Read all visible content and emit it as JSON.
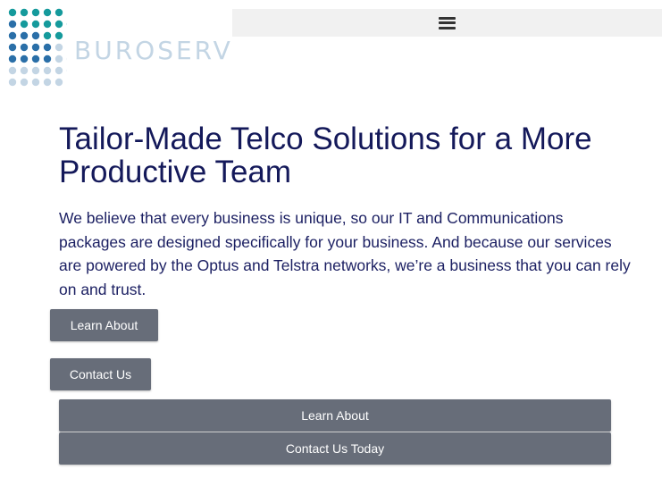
{
  "logo": {
    "text": "BUROSERV",
    "colors": {
      "teal": "#159a9c",
      "blue": "#2a6fa8",
      "light": "#c3d5e4"
    }
  },
  "header": {
    "menu_icon": "hamburger-menu-icon"
  },
  "hero": {
    "title": "Tailor-Made Telco Solutions for a More Productive Team",
    "body": "We believe that every business is unique, so our IT and Communications packages are designed specifically for your business. And because our services are powered by the Optus and Telstra networks, we’re a business that you can rely on and trust."
  },
  "buttons": {
    "learn_about": "Learn About",
    "contact_us": "Contact Us",
    "learn_about_wide": "Learn About",
    "contact_us_today": "Contact Us Today"
  },
  "colors": {
    "heading": "#14195a",
    "button_bg": "#676d79",
    "menu_bar_bg": "#f1f1f1"
  }
}
